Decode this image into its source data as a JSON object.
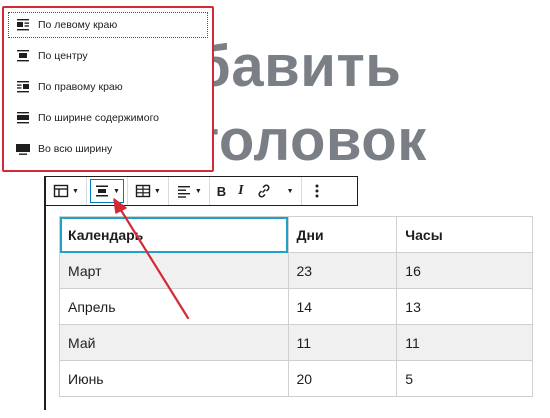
{
  "heading": {
    "line1": "бавить",
    "line2": "головок"
  },
  "toolbar": {
    "table_button_icon": "table-icon",
    "align_button_icon": "align-center-icon",
    "edit_table_icon": "table-edit-icon",
    "text_align_icon": "text-align-left-icon",
    "bold_label": "B",
    "italic_label": "I",
    "link_icon": "link-icon",
    "more_rich_icon": "chevron-down-icon",
    "options_icon": "more-vertical-icon"
  },
  "align_menu": {
    "items": [
      {
        "label": "По левому краю",
        "icon": "align-left-icon"
      },
      {
        "label": "По центру",
        "icon": "align-center-icon"
      },
      {
        "label": "По правому краю",
        "icon": "align-right-icon"
      },
      {
        "label": "По ширине содержимого",
        "icon": "align-wide-icon"
      },
      {
        "label": "Во всю ширину",
        "icon": "align-full-icon"
      }
    ]
  },
  "table": {
    "header": [
      "Календарь",
      "Дни",
      "Часы"
    ],
    "rows": [
      [
        "Март",
        "23",
        "16"
      ],
      [
        "Апрель",
        "14",
        "13"
      ],
      [
        "Май",
        "11",
        "11"
      ],
      [
        "Июнь",
        "20",
        "5"
      ]
    ]
  },
  "colors": {
    "annotation_red": "#d42a36",
    "selection_blue": "#21a0c8",
    "heading_gray": "#7a7f86"
  }
}
